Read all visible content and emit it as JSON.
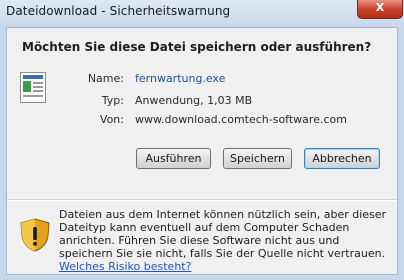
{
  "window": {
    "title": "Dateidownload - Sicherheitswarnung",
    "close_label": "X"
  },
  "dialog": {
    "question": "Möchten Sie diese Datei speichern oder ausführen?",
    "fields": {
      "name_label": "Name:",
      "name_value": "fernwartung.exe",
      "type_label": "Typ:",
      "type_value": "Anwendung, 1,03 MB",
      "from_label": "Von:",
      "from_value": "www.download.comtech-software.com"
    },
    "buttons": {
      "run": "Ausführen",
      "save": "Speichern",
      "cancel": "Abbrechen"
    },
    "warning": {
      "text": "Dateien aus dem Internet können nützlich sein, aber dieser Dateityp kann eventuell auf dem Computer Schaden anrichten. Führen Sie diese Software nicht aus und speichern Sie sie nicht, falls Sie der Quelle nicht vertrauen.",
      "link": "Welches Risiko besteht?"
    }
  },
  "icons": {
    "file": "application-file-icon",
    "shield": "security-shield-icon"
  },
  "colors": {
    "link": "#1f55c9",
    "close_button": "#c9412c"
  }
}
